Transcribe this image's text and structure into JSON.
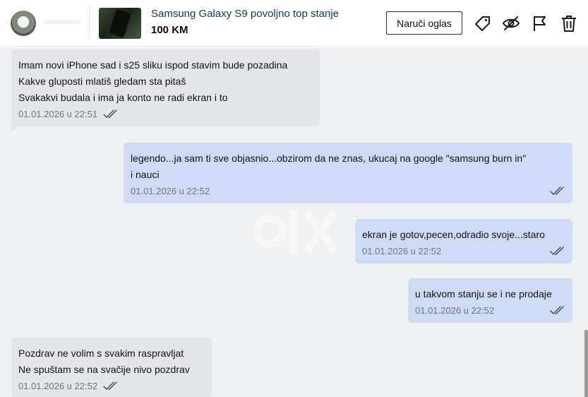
{
  "header": {
    "item_title": "Samsung Galaxy S9 povoljno top stanje",
    "item_price": "100 KM",
    "order_button_label": "Naruči oglas",
    "icons": [
      "tag-icon",
      "hide-eye-icon",
      "flag-icon",
      "trash-icon"
    ]
  },
  "messages": [
    {
      "direction": "incoming",
      "lines": [
        "Imam novi iPhone sad i s25 sliku ispod stavim bude pozadina",
        "Kakve gluposti mlatiš gledam sta pitaš",
        "Svakakvi budala i ima ja konto ne radi ekran i to"
      ],
      "timestamp": "01.01.2026  u  22:51"
    },
    {
      "direction": "outgoing",
      "lines": [
        "legendo...ja sam ti sve objasnio...obzirom da ne znas, ukucaj na google \"samsung burn in\"",
        "i nauci"
      ],
      "timestamp": "01.01.2026  u  22:52"
    },
    {
      "direction": "outgoing",
      "lines": [
        "ekran je gotov,pecen,odradio svoje...staro"
      ],
      "timestamp": "01.01.2026  u  22:52"
    },
    {
      "direction": "outgoing",
      "lines": [
        "u takvom stanju se i ne prodaje"
      ],
      "timestamp": "01.01.2026  u  22:52"
    },
    {
      "direction": "incoming",
      "lines": [
        "Pozdrav ne volim s svakim raspravljat",
        "Ne spuštam se na svačije nivo pozdrav"
      ],
      "timestamp": "01.01.2026  u  22:52"
    }
  ],
  "colors": {
    "incoming_bubble": "#e4e5e8",
    "outgoing_bubble": "#cfdbf6",
    "chat_background": "#eff0f2",
    "title_color": "#0c3b52",
    "read_ticks": "#3a4b5c"
  }
}
